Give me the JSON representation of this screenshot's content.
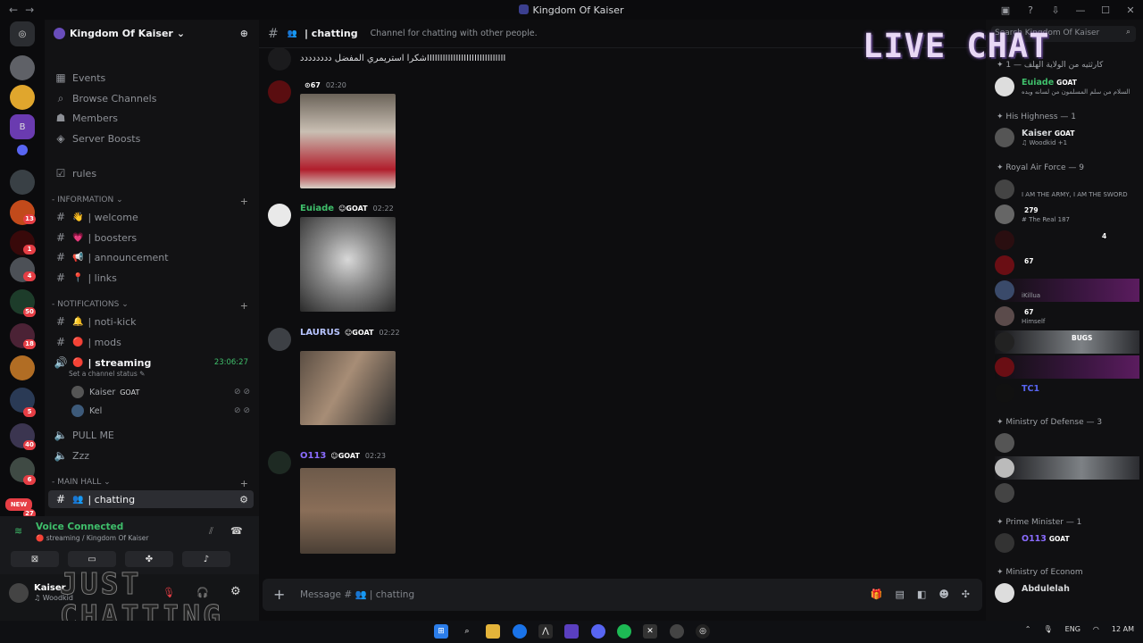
{
  "window": {
    "title": "Kingdom Of Kaiser"
  },
  "server": {
    "name": "Kingdom Of Kaiser"
  },
  "nav_top": [
    {
      "label": "Events",
      "icon": "calendar-icon"
    },
    {
      "label": "Browse Channels",
      "icon": "browse-icon"
    },
    {
      "label": "Members",
      "icon": "members-icon"
    },
    {
      "label": "Server Boosts",
      "icon": "boost-icon"
    }
  ],
  "rules": {
    "label": "rules"
  },
  "categories": {
    "information": "INFORMATION",
    "notifications": "NOTIFICATIONS",
    "main_hall": "MAIN HALL"
  },
  "info_channels": [
    {
      "label": "| welcome",
      "emoji": "👋"
    },
    {
      "label": "| boosters",
      "emoji": "💗"
    },
    {
      "label": "| announcement",
      "emoji": "📢"
    },
    {
      "label": "| links",
      "emoji": "📍"
    }
  ],
  "notif_channels": [
    {
      "label": "| noti-kick",
      "emoji": "🔔"
    },
    {
      "label": "| mods",
      "emoji": "🔴"
    }
  ],
  "streaming": {
    "label": "| streaming",
    "time": "23:06:27",
    "status": "Set a channel status",
    "users": [
      {
        "name": "Kaiser",
        "tag": "GOAT"
      },
      {
        "name": "Kel",
        "tag": ""
      }
    ]
  },
  "voice_channels": [
    {
      "label": "PULL ME"
    },
    {
      "label": "Zzz"
    }
  ],
  "active_channel": {
    "label": "| chatting"
  },
  "voice": {
    "status": "Voice Connected",
    "sub": "streaming / Kingdom Of Kaiser"
  },
  "user": {
    "name": "Kaiser",
    "sub": "Woodkid"
  },
  "overlay": {
    "just": "JUST",
    "chatting": "CHATTING",
    "live": "LIVE CHAT"
  },
  "channel_header": {
    "name": "| chatting",
    "topic": "Channel for chatting with other people."
  },
  "messages": [
    {
      "user": "",
      "tag": "",
      "time": "",
      "text": "شكرا استريمري المفضل ددددددددIIIIIIIIIIIIIIIIIIIIIIIIIIIIII",
      "color": "#d8c9a8"
    },
    {
      "user": "",
      "tag": "67",
      "time": "02:20",
      "text": "",
      "color": "#c0282c"
    },
    {
      "user": "Euiade",
      "tag": "GOAT",
      "time": "02:22",
      "text": "",
      "color": "#3fbf6b"
    },
    {
      "user": "LAURUS",
      "tag": "GOAT",
      "time": "02:22",
      "text": "",
      "color": "#b7c4ff"
    },
    {
      "user": "O113",
      "tag": "GOAT",
      "time": "02:23",
      "text": "",
      "color": "#8a6cff"
    }
  ],
  "composer": {
    "placeholder": "Message #",
    "channel": "| chatting"
  },
  "search": {
    "placeholder": "Search Kingdom Of Kaiser"
  },
  "roles": [
    {
      "title": "✦ كارثتيه من الولاية الهلف — 1"
    },
    {
      "title": "✦ His Highness — 1"
    },
    {
      "title": "✦ Royal Air Force — 9"
    },
    {
      "title": "✦ Ministry of Defense — 3"
    },
    {
      "title": "✦ Prime Minister — 1"
    },
    {
      "title": "✦ Ministry of Econom"
    }
  ],
  "members": [
    {
      "name": "Euiade",
      "tag": "GOAT",
      "sub": "السلام من سلم المسلمون من لسانه ويده",
      "color": "#3fbf6b"
    },
    {
      "name": "Kaiser",
      "tag": "GOAT",
      "sub": "Woodkid +1",
      "color": "#d8dadc"
    },
    {
      "name": "",
      "tag": "",
      "sub": "I AM THE ARMY, I AM THE SWORD",
      "color": "#c0282c"
    },
    {
      "name": "",
      "tag": "279",
      "sub": "The Real 187",
      "color": "#c0282c"
    },
    {
      "name": "",
      "tag": "4",
      "sub": "",
      "color": "#c0282c"
    },
    {
      "name": "",
      "tag": "67",
      "sub": "",
      "color": "#c0282c"
    },
    {
      "name": "",
      "tag": "",
      "sub": "iKillua",
      "color": "#c0282c"
    },
    {
      "name": "",
      "tag": "67",
      "sub": "Himself",
      "color": "#c0282c"
    },
    {
      "name": "",
      "tag": "BUGS",
      "sub": "",
      "color": "#c0282c"
    },
    {
      "name": "",
      "tag": "",
      "sub": "",
      "color": "#c0282c"
    },
    {
      "name": "TC1",
      "tag": "",
      "sub": "",
      "color": "#5865f2"
    },
    {
      "name": "",
      "tag": "",
      "sub": "",
      "color": "#c0282c"
    },
    {
      "name": "",
      "tag": "",
      "sub": "",
      "color": "#c0282c"
    },
    {
      "name": "",
      "tag": "",
      "sub": "",
      "color": "#c0282c"
    },
    {
      "name": "O113",
      "tag": "GOAT",
      "sub": "",
      "color": "#8a6cff"
    },
    {
      "name": "Abdulelah",
      "tag": "",
      "sub": "",
      "color": "#d8dadc"
    }
  ],
  "badges": [
    "13",
    "1",
    "4",
    "50",
    "18",
    "5",
    "40",
    "6",
    "27",
    "NEW"
  ],
  "taskbar": {
    "lang": "ENG",
    "clock": "12 AM"
  }
}
